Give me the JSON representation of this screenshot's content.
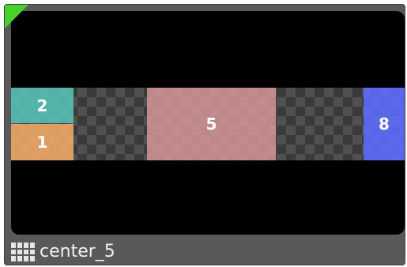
{
  "layout": {
    "name": "center_5",
    "icon": "grid-layout-icon",
    "selected": true,
    "accent_color": "#48d12c"
  },
  "regions": [
    {
      "label": "2",
      "color": "#58c2b6"
    },
    {
      "label": "1",
      "color": "#f2aa68"
    },
    {
      "label": "5",
      "color": "#d69696"
    },
    {
      "label": "8",
      "color": "#5c6cff"
    }
  ]
}
